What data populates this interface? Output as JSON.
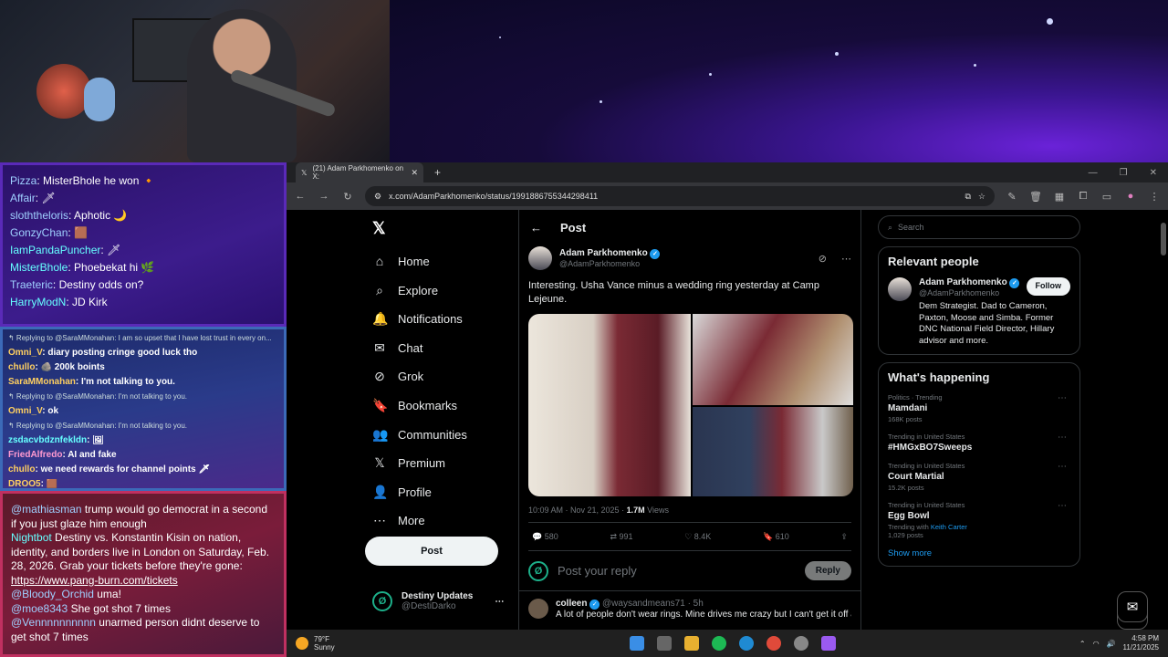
{
  "stream_chat_top": [
    {
      "user": "Pizza",
      "msg": "MisterBhole he won 🔸",
      "cls": "nm-a"
    },
    {
      "user": "Affair",
      "msg": "🗡",
      "cls": "nm-a"
    },
    {
      "user": "sloththeloris",
      "msg": "Aphotic 🌙",
      "cls": "nm-a"
    },
    {
      "user": "GonzyChan",
      "msg": "🟫",
      "cls": "nm-a"
    },
    {
      "user": "IamPandaPuncher",
      "msg": "🗡",
      "cls": "nm-c"
    },
    {
      "user": "MisterBhole",
      "msg": "Phoebekat hi 🌿",
      "cls": "nm-c"
    },
    {
      "user": "Traeteric",
      "msg": "Destiny odds on?",
      "cls": "nm-a"
    },
    {
      "user": "HarryModN",
      "msg": "JD Kirk",
      "cls": "nm-c"
    }
  ],
  "stream_chat_mid": [
    {
      "reply": "↰ Replying to @SaraMMonahan: I am so upset that I have lost trust in every on..."
    },
    {
      "user": "Omni_V",
      "msg": "diary posting cringe good luck tho",
      "cls": "nm-y"
    },
    {
      "user": "chullo",
      "msg": "🪨 200k boints",
      "cls": "nm-y"
    },
    {
      "user": "SaraMMonahan",
      "msg": "I'm not talking to you.",
      "cls": "nm-y"
    },
    {
      "reply": "↰ Replying to @SaraMMonahan: I'm not talking to you."
    },
    {
      "user": "Omni_V",
      "msg": "ok",
      "cls": "nm-y"
    },
    {
      "reply": "↰ Replying to @SaraMMonahan: I'm not talking to you."
    },
    {
      "user": "zsdacvbdznfekldn",
      "msg": "🖼",
      "cls": "nm-c"
    },
    {
      "user": "FriedAlfredo",
      "msg": "AI and fake",
      "cls": "nm-p"
    },
    {
      "user": "chullo",
      "msg": "we need rewards for channel points 🗡",
      "cls": "nm-y"
    },
    {
      "user": "DROO5",
      "msg": "🟫",
      "cls": "nm-y"
    }
  ],
  "stream_chat_bottom": [
    {
      "user": "@mathiasman",
      "msg": "trump would go democrat in a second if you just glaze him enough"
    },
    {
      "user": "Nightbot",
      "msg": "Destiny vs. Konstantin Kisin on nation, identity, and borders live in London on Saturday, Feb. 28, 2026. Grab your tickets before they're gone:",
      "link": "https://www.pang-burn.com/tickets"
    },
    {
      "user": "@Bloody_Orchid",
      "msg": "uma!"
    },
    {
      "user": "@moe8343",
      "msg": "She got shot 7 times"
    },
    {
      "user": "@Vennnnnnnnnn",
      "msg": "unarmed person didnt deserve to get shot 7 times"
    }
  ],
  "browser": {
    "tab_title": "(21) Adam Parkhomenko on X:",
    "url": "x.com/AdamParkhomenko/status/1991886755344298411"
  },
  "nav": {
    "items": [
      {
        "label": "Home",
        "icon": "⌂"
      },
      {
        "label": "Explore",
        "icon": "⌕"
      },
      {
        "label": "Notifications",
        "icon": "🔔"
      },
      {
        "label": "Chat",
        "icon": "✉"
      },
      {
        "label": "Grok",
        "icon": "⊘"
      },
      {
        "label": "Bookmarks",
        "icon": "🔖"
      },
      {
        "label": "Communities",
        "icon": "👥"
      },
      {
        "label": "Premium",
        "icon": "𝕏"
      },
      {
        "label": "Profile",
        "icon": "👤"
      },
      {
        "label": "More",
        "icon": "⋯"
      }
    ],
    "notif_badge": "20+",
    "post_label": "Post",
    "account_name": "Destiny Updates",
    "account_handle": "@DestiDarko"
  },
  "post": {
    "header": "Post",
    "author": "Adam Parkhomenko",
    "handle": "@AdamParkhomenko",
    "text": "Interesting. Usha Vance minus a wedding ring yesterday at Camp Lejeune.",
    "time": "10:09 AM · Nov 21, 2025 ·",
    "views": "1.7M",
    "views_label": "Views",
    "replies": "580",
    "reposts": "991",
    "likes": "8.4K",
    "bookmarks": "610",
    "reply_placeholder": "Post your reply",
    "reply_button": "Reply",
    "next_author": "colleen",
    "next_handle": "@waysandmeans71 · 5h",
    "next_text": "A lot of people don't wear rings. Mine drives me crazy but I can't get it off at"
  },
  "right": {
    "search_placeholder": "Search",
    "relevant_title": "Relevant people",
    "person_name": "Adam Parkhomenko",
    "person_handle": "@AdamParkhomenko",
    "follow_label": "Follow",
    "person_bio": "Dem Strategist. Dad to Cameron, Paxton, Moose and Simba. Former DNC National Field Director, Hillary advisor and more.",
    "happening_title": "What's happening",
    "trends": [
      {
        "context": "Politics · Trending",
        "title": "Mamdani",
        "posts": "168K posts"
      },
      {
        "context": "Trending in United States",
        "title": "#HMGxBO7Sweeps",
        "posts": ""
      },
      {
        "context": "Trending in United States",
        "title": "Court Martial",
        "posts": "15.2K posts"
      },
      {
        "context": "Trending in United States",
        "title": "Egg Bowl",
        "posts": "1,029 posts",
        "with": "Trending with",
        "with_link": "Keith Carter"
      }
    ],
    "show_more": "Show more"
  },
  "taskbar": {
    "temp": "79°F",
    "weather": "Sunny",
    "time": "4:58 PM",
    "date": "11/21/2025"
  }
}
